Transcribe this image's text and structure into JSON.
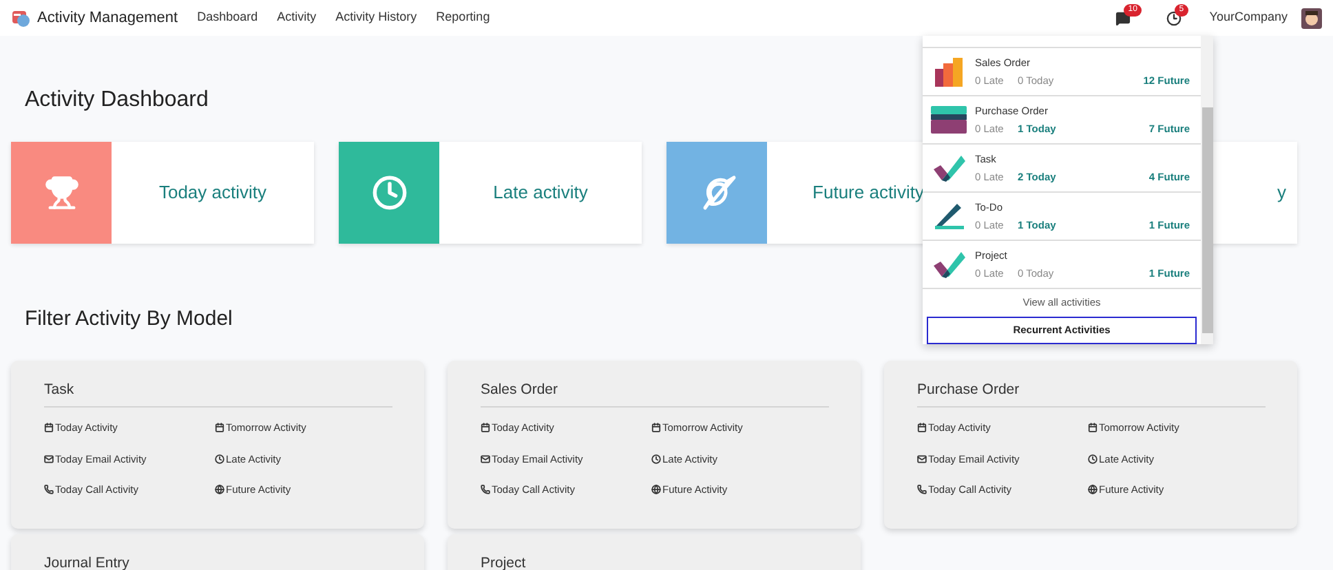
{
  "navbar": {
    "app_title": "Activity Management",
    "menu": [
      "Dashboard",
      "Activity",
      "Activity History",
      "Reporting"
    ],
    "messages_badge": "10",
    "activities_badge": "5",
    "company": "YourCompany"
  },
  "dashboard": {
    "title": "Activity Dashboard",
    "cards": [
      {
        "label": "Today activity",
        "kind": "today"
      },
      {
        "label": "Late activity",
        "kind": "late"
      },
      {
        "label": "Future activity",
        "kind": "future"
      },
      {
        "label": "y",
        "kind": "partial"
      }
    ]
  },
  "filter": {
    "title": "Filter Activity By Model",
    "models": [
      {
        "name": "Task",
        "links": [
          "Today Activity",
          "Tomorrow Activity",
          "Today Email Activity",
          "Late Activity",
          "Today Call Activity",
          "Future Activity"
        ]
      },
      {
        "name": "Sales Order",
        "links": [
          "Today Activity",
          "Tomorrow Activity",
          "Today Email Activity",
          "Late Activity",
          "Today Call Activity",
          "Future Activity"
        ]
      },
      {
        "name": "Purchase Order",
        "links": [
          "Today Activity",
          "Tomorrow Activity",
          "Today Email Activity",
          "Late Activity",
          "Today Call Activity",
          "Future Activity"
        ]
      },
      {
        "name": "Journal Entry"
      },
      {
        "name": "Project"
      }
    ]
  },
  "activity_menu": {
    "rows": [
      {
        "kind": "sales",
        "name": "Sales Order",
        "late": "0 Late",
        "today": "0 Today",
        "today_active": false,
        "future": "12 Future"
      },
      {
        "kind": "purchase",
        "name": "Purchase Order",
        "late": "0 Late",
        "today": "1 Today",
        "today_active": true,
        "future": "7 Future"
      },
      {
        "kind": "task",
        "name": "Task",
        "late": "0 Late",
        "today": "2 Today",
        "today_active": true,
        "future": "4 Future"
      },
      {
        "kind": "todo",
        "name": "To-Do",
        "late": "0 Late",
        "today": "1 Today",
        "today_active": true,
        "future": "1 Future"
      },
      {
        "kind": "task",
        "name": "Project",
        "late": "0 Late",
        "today": "0 Today",
        "today_active": false,
        "future": "1 Future"
      }
    ],
    "view_all": "View all activities",
    "recurrent_button": "Recurrent Activities"
  }
}
